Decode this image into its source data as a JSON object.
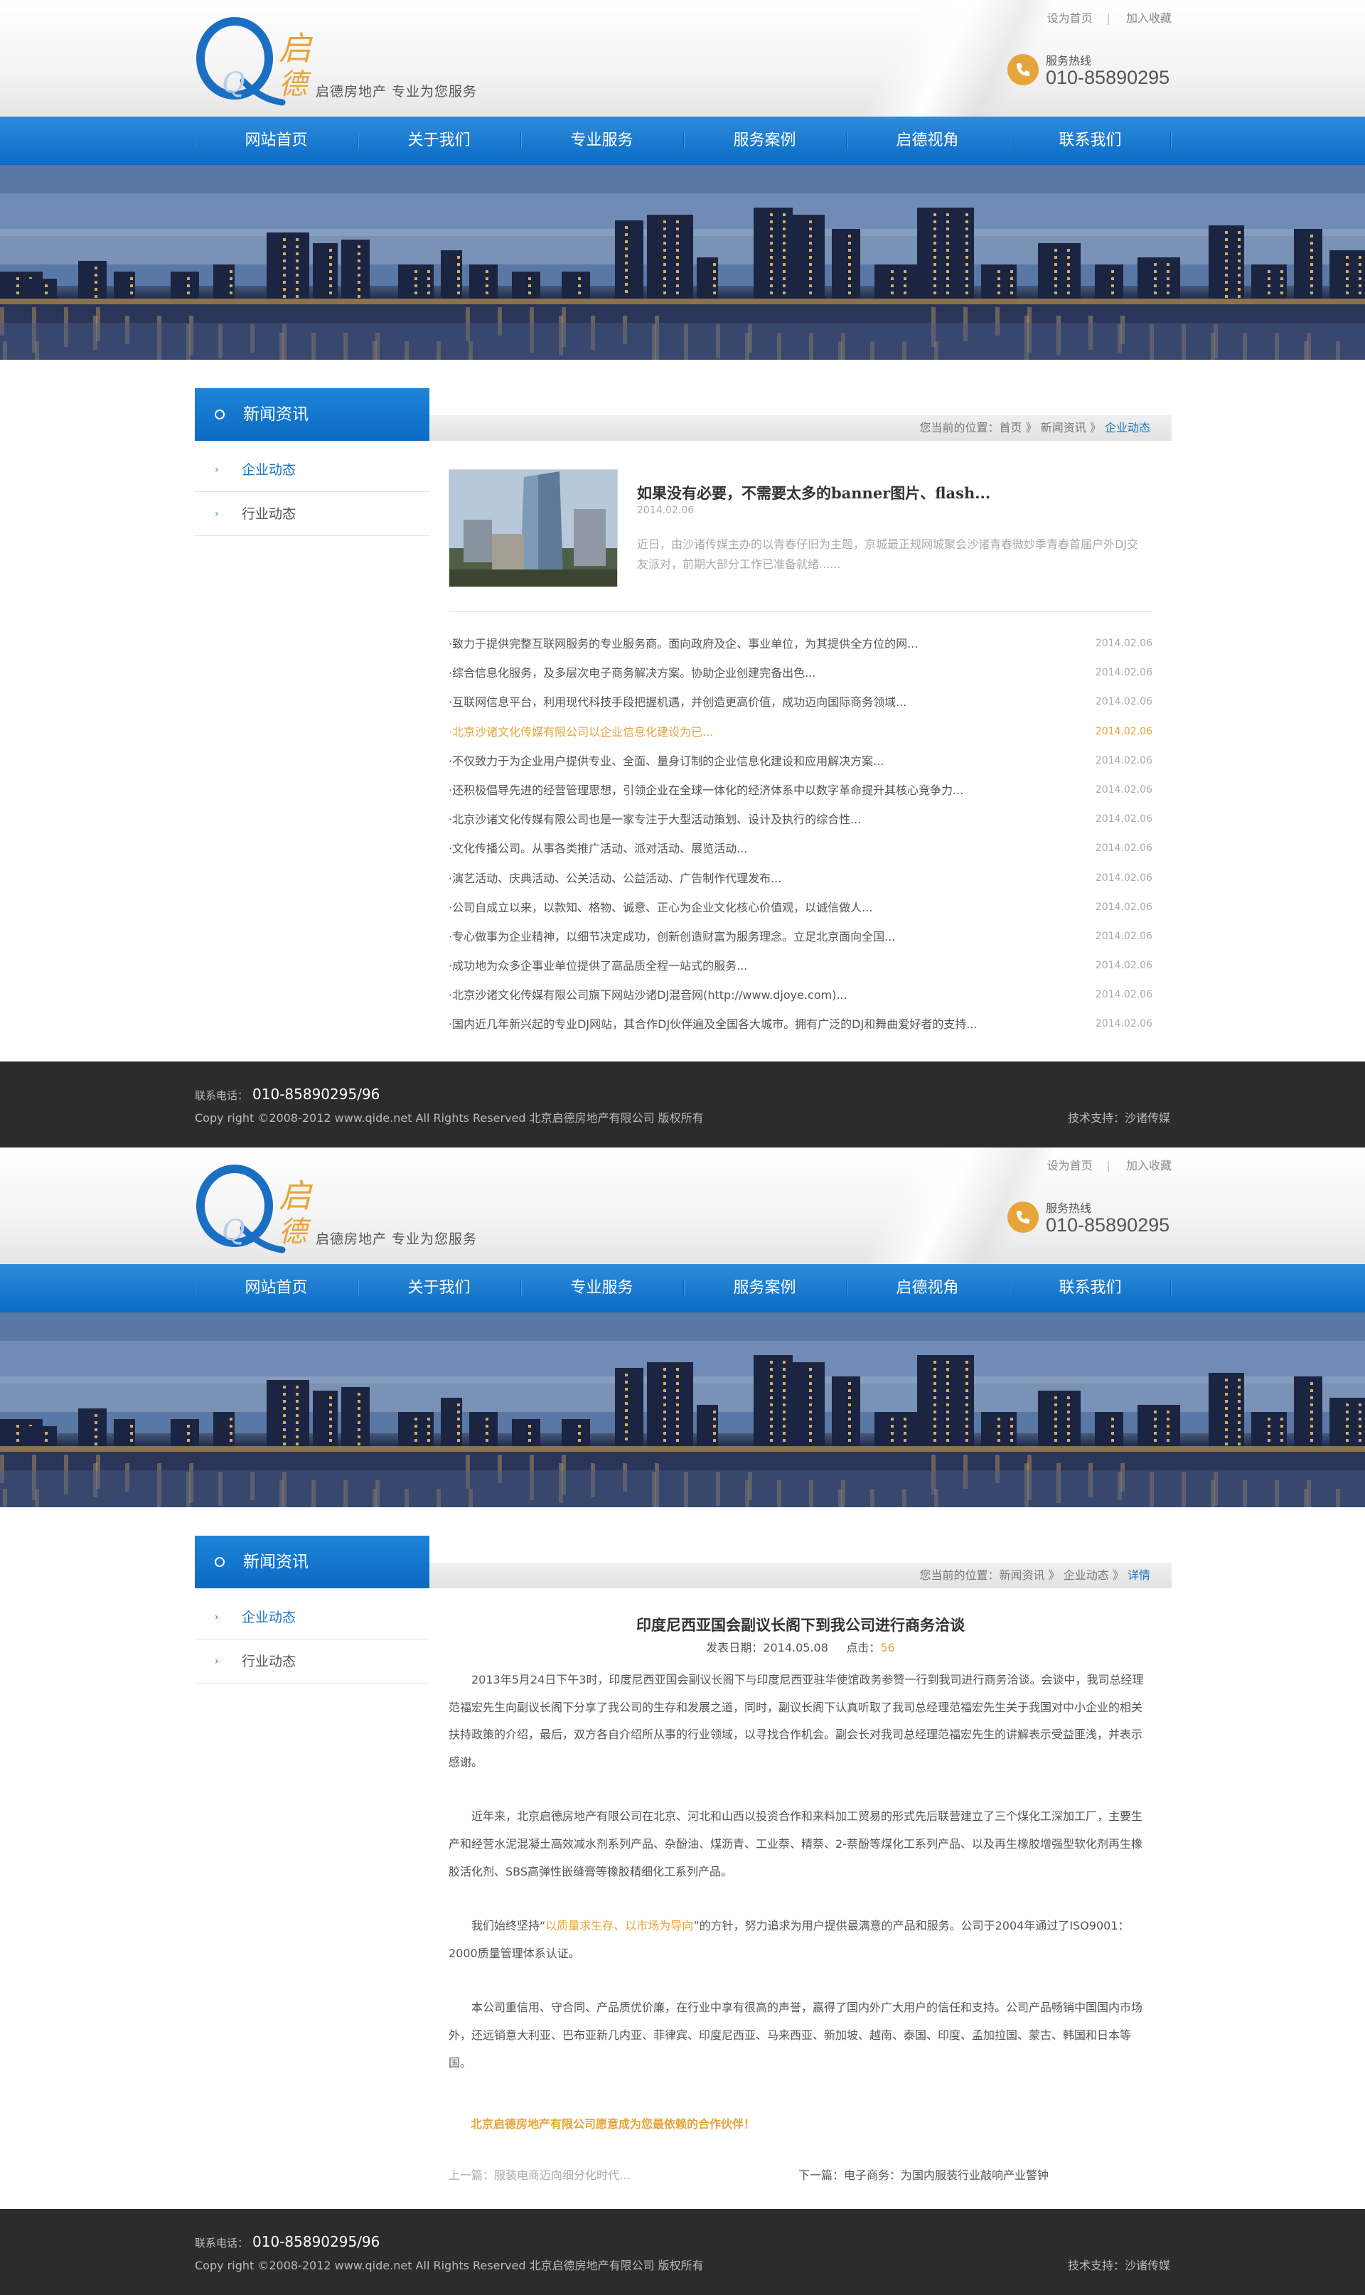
{
  "header": {
    "logo_char_qi": "启",
    "logo_char_de": "德",
    "slogan": "启德房地产   专业为您服务",
    "links": [
      "设为首页",
      "加入收藏"
    ],
    "hotline_label": "服务热线",
    "hotline_number": "010-85890295"
  },
  "nav": [
    "网站首页",
    "关于我们",
    "专业服务",
    "服务案例",
    "启德视角",
    "联系我们"
  ],
  "sidebar": {
    "title": "新闻资讯",
    "items": [
      "企业动态",
      "行业动态"
    ]
  },
  "list_page": {
    "breadcrumb": {
      "prefix": "您当前的位置：",
      "home": "首页",
      "sep": "》",
      "section": "新闻资讯",
      "current": "企业动态"
    },
    "featured": {
      "title": "如果没有必要，不需要太多的banner图片、flash...",
      "date": "2014.02.06",
      "desc": "近日，由沙诸传媒主办的以青春仔旧为主题，京城最正规网城聚会沙诸青春微妙季青春首届户外DJ交友派对，前期大部分工作已准备就绪......"
    },
    "news": [
      {
        "title": "·致力于提供完整互联网服务的专业服务商。面向政府及企、事业单位，为其提供全方位的网...",
        "date": "2014.02.06",
        "highlight": false
      },
      {
        "title": "·综合信息化服务，及多层次电子商务解决方案。协助企业创建完备出色...",
        "date": "2014.02.06",
        "highlight": false
      },
      {
        "title": "·互联网信息平台，利用现代科技手段把握机遇，并创造更高价值，成功迈向国际商务领域...",
        "date": "2014.02.06",
        "highlight": false
      },
      {
        "title": "·北京沙诸文化传媒有限公司以企业信息化建设为已...",
        "date": "2014.02.06",
        "highlight": true
      },
      {
        "title": "·不仅致力于为企业用户提供专业、全面、量身订制的企业信息化建设和应用解决方案...",
        "date": "2014.02.06",
        "highlight": false
      },
      {
        "title": "·还积极倡导先进的经营管理思想，引领企业在全球一体化的经济体系中以数字革命提升其核心竞争力...",
        "date": "2014.02.06",
        "highlight": false
      },
      {
        "title": "·北京沙诸文化传媒有限公司也是一家专注于大型活动策划、设计及执行的综合性...",
        "date": "2014.02.06",
        "highlight": false
      },
      {
        "title": "·文化传播公司。从事各类推广活动、派对活动、展览活动...",
        "date": "2014.02.06",
        "highlight": false
      },
      {
        "title": "·演艺活动、庆典活动、公关活动、公益活动、广告制作代理发布...",
        "date": "2014.02.06",
        "highlight": false
      },
      {
        "title": "·公司自成立以来，以款知、格物、诚意、正心为企业文化核心价值观，以诚信做人...",
        "date": "2014.02.06",
        "highlight": false
      },
      {
        "title": "·专心做事为企业精神，以细节决定成功，创新创造财富为服务理念。立足北京面向全国...",
        "date": "2014.02.06",
        "highlight": false
      },
      {
        "title": "·成功地为众多企事业单位提供了高品质全程一站式的服务...",
        "date": "2014.02.06",
        "highlight": false
      },
      {
        "title": "·北京沙诸文化传媒有限公司旗下网站沙诸DJ混音网(http://www.djoye.com)...",
        "date": "2014.02.06",
        "highlight": false
      },
      {
        "title": "·国内近几年新兴起的专业DJ网站，其合作DJ伙伴遍及全国各大城市。拥有广泛的DJ和舞曲爱好者的支持...",
        "date": "2014.02.06",
        "highlight": false
      }
    ]
  },
  "detail_page": {
    "breadcrumb": {
      "prefix": "您当前的位置：",
      "section": "新闻资讯",
      "sep": "》",
      "sub": "企业动态",
      "current": "详情"
    },
    "title": "印度尼西亚国会副议长阁下到我公司进行商务洽谈",
    "date_label": "发表日期：2014.05.08",
    "clicks_label": "点击：",
    "clicks": "56",
    "paragraphs": [
      "2013年5月24日下午3时，印度尼西亚国会副议长阁下与印度尼西亚驻华使馆政务参赞一行到我司进行商务洽谈。会谈中，我司总经理范福宏先生向副议长阁下分享了我公司的生存和发展之道，同时，副议长阁下认真听取了我司总经理范福宏先生关于我国对中小企业的相关扶持政策的介绍，最后，双方各自介绍所从事的行业领域，以寻找合作机会。副会长对我司总经理范福宏先生的讲解表示受益匪浅，并表示感谢。",
      "近年来，北京启德房地产有限公司在北京、河北和山西以投资合作和来料加工贸易的形式先后联营建立了三个煤化工深加工厂，主要生产和经营水泥混凝土高效减水剂系列产品、杂酚油、煤沥青、工业萘、精萘、2-萘酚等煤化工系列产品、以及再生橡胶增强型软化剂再生橡胶活化剂、SBS高弹性嵌缝膏等橡胶精细化工系列产品。",
      "我们始终坚持“",
      "以质量求生存、以市场为导向",
      "”的方针，努力追求为用户提供最满意的产品和服务。公司于2004年通过了ISO9001：2000质量管理体系认证。",
      "本公司重信用、守合同、产品质优价廉，在行业中享有很高的声誉，赢得了国内外广大用户的信任和支持。公司产品畅销中国国内市场外，还远销意大利亚、巴布亚新几内亚、菲律宾、印度尼西亚、马来西亚、新加坡、越南、泰国、印度、孟加拉国、蒙古、韩国和日本等国。"
    ],
    "slogan": "北京启德房地产有限公司愿意成为您最依赖的合作伙伴！",
    "prev": "上一篇：服装电商迈向细分化时代...",
    "next": "下一篇：电子商务：为国内服装行业敲响产业警钟"
  },
  "footer": {
    "tel_label": "联系电话：",
    "tel": "010-85890295/96",
    "copyright": "Copy right ©2008-2012 www.qide.net All Rights Reserved    北京启德房地产有限公司 版权所有",
    "tech": "技术支持：沙诸传媒"
  },
  "colors": {
    "nav_blue": "#0b6cc6",
    "accent_orange": "#e6a43a",
    "footer_bg": "#2c2c2c"
  }
}
